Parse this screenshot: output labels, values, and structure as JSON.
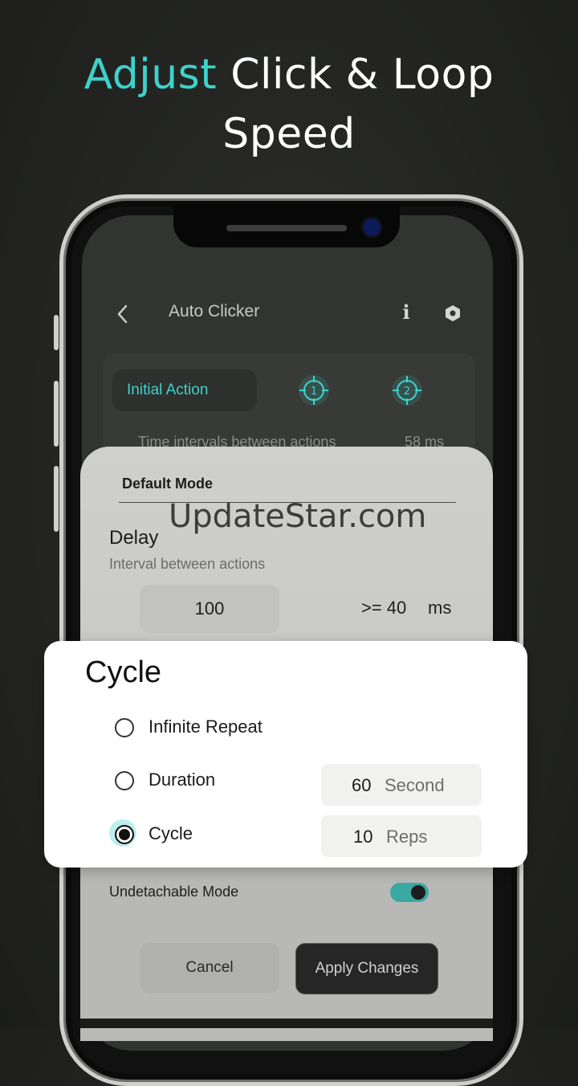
{
  "headline": {
    "accent": "Adjust",
    "rest": "Click & Loop",
    "line2": "Speed"
  },
  "app": {
    "title": "Auto Clicker",
    "back_icon": "chevron-left-icon",
    "info_icon": "info-icon",
    "info_glyph": "i",
    "settings_icon": "hexagon-settings-icon"
  },
  "actions": {
    "initial_action_label": "Initial Action",
    "targets": [
      "1",
      "2"
    ],
    "interval_label": "Time intervals between actions",
    "interval_value": "58 ms"
  },
  "sheet": {
    "mode_title": "Default Mode",
    "watermark": "UpdateStar.com",
    "delay_title": "Delay",
    "delay_subtitle": "Interval between actions",
    "delay_value": "100",
    "delay_min": ">= 40",
    "delay_unit": "ms"
  },
  "cycle_card": {
    "title": "Cycle",
    "options": [
      {
        "label": "Infinite Repeat",
        "selected": false
      },
      {
        "label": "Duration",
        "selected": false,
        "value": "60",
        "unit": "Second"
      },
      {
        "label": "Cycle",
        "selected": true,
        "value": "10",
        "unit": "Reps"
      }
    ]
  },
  "undetachable": {
    "label": "Undetachable Mode",
    "enabled": true
  },
  "buttons": {
    "cancel": "Cancel",
    "apply": "Apply Changes"
  },
  "colors": {
    "accent": "#3ed2cc",
    "toggle": "#3aa9a2",
    "background": "#232421"
  }
}
